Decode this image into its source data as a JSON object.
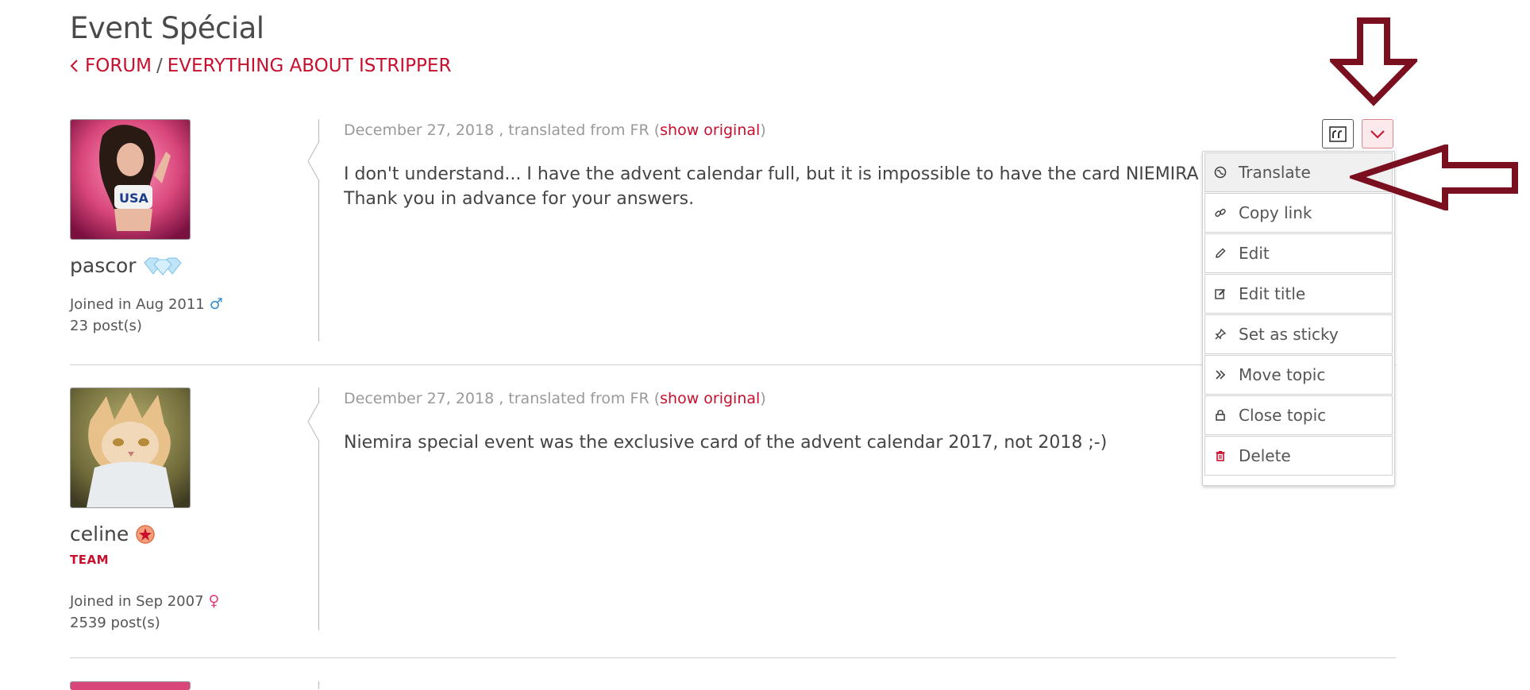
{
  "page": {
    "title": "Event Spécial"
  },
  "breadcrumb": {
    "forum": "FORUM",
    "separator": "/",
    "section": "EVERYTHING ABOUT ISTRIPPER"
  },
  "posts": [
    {
      "username": "pascor",
      "badge": "diamonds-icon",
      "joined": "Joined in Aug 2011",
      "gender_icon": "male-icon",
      "posts_count": "23 post(s)",
      "meta": "December 27, 2018 , translated from FR (",
      "show_original": "show original",
      "meta_close": ")",
      "lines": [
        "I don't understand... I have the advent calendar full, but it is impossible to have the card NIEMIRA in a spe",
        "Thank you in advance for your answers."
      ]
    },
    {
      "username": "celine",
      "badge": "star-badge-icon",
      "role": "TEAM",
      "joined": "Joined in Sep 2007",
      "gender_icon": "female-icon",
      "posts_count": "2539 post(s)",
      "meta": "December 27, 2018 , translated from FR (",
      "show_original": "show original",
      "meta_close": ")",
      "lines": [
        "Niemira special event was the exclusive card of the advent calendar 2017, not 2018 ;-)"
      ]
    }
  ],
  "menu": {
    "items": [
      {
        "label": "Translate",
        "icon": "globe-icon"
      },
      {
        "label": "Copy link",
        "icon": "link-icon"
      },
      {
        "label": "Edit",
        "icon": "pencil-icon"
      },
      {
        "label": "Edit title",
        "icon": "edit-box-icon"
      },
      {
        "label": "Set as sticky",
        "icon": "pin-icon"
      },
      {
        "label": "Move topic",
        "icon": "double-chevron-icon"
      },
      {
        "label": "Close topic",
        "icon": "lock-icon"
      },
      {
        "label": "Delete",
        "icon": "trash-icon"
      }
    ]
  },
  "colors": {
    "accent": "#c8102e",
    "annotation": "#7a0f1f"
  }
}
